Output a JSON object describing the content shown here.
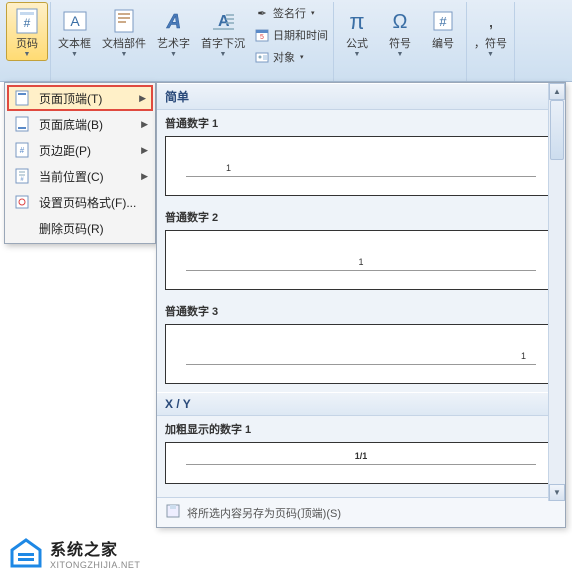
{
  "ribbon": {
    "page_number": "页码",
    "text_box": "文本框",
    "doc_parts": "文档部件",
    "word_art": "艺术字",
    "drop_cap": "首字下沉",
    "signature": "签名行",
    "date_time": "日期和时间",
    "object": "对象",
    "equation": "公式",
    "symbol": "符号",
    "number": "编号",
    "comma_symbol": "，符号"
  },
  "dropdown": {
    "top": "页面顶端(T)",
    "bottom": "页面底端(B)",
    "margins": "页边距(P)",
    "current": "当前位置(C)",
    "format": "设置页码格式(F)...",
    "remove": "删除页码(R)"
  },
  "gallery": {
    "cat_simple": "简单",
    "plain1": "普通数字 1",
    "plain2": "普通数字 2",
    "plain3": "普通数字 3",
    "cat_xy": "X / Y",
    "bold1": "加粗显示的数字 1",
    "sample1": "1",
    "sample_xy": "1/1",
    "footer": "将所选内容另存为页码(顶端)(S)"
  },
  "watermark": {
    "cn": "系统之家",
    "en": "XITONGZHIJIA.NET"
  }
}
